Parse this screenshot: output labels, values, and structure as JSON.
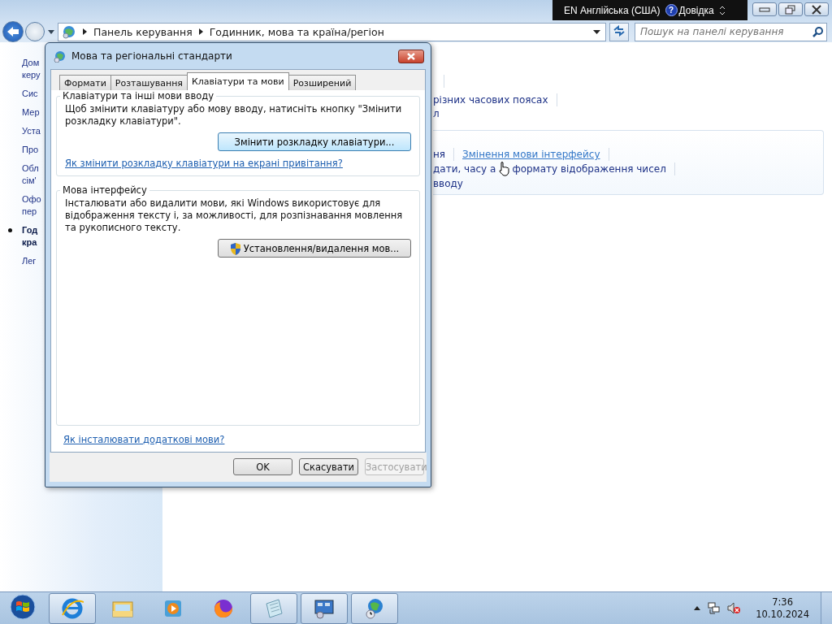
{
  "window": {
    "language_bar": {
      "language": "EN Англійська (США)",
      "help_icon": "?",
      "help": "Довідка"
    },
    "breadcrumbs": [
      "Панель керування",
      "Годинник, мова та країна/регіон"
    ],
    "search": {
      "placeholder": "Пошук на панелі керування"
    }
  },
  "sidebar": {
    "items": [
      {
        "lines": [
          "Дом",
          "керу"
        ],
        "selected": false
      },
      {
        "lines": [
          "Сис"
        ],
        "selected": false
      },
      {
        "lines": [
          "Мер"
        ],
        "selected": false
      },
      {
        "lines": [
          "Уста"
        ],
        "selected": false
      },
      {
        "lines": [
          "Про"
        ],
        "selected": false
      },
      {
        "lines": [
          "Обл",
          "сім'"
        ],
        "selected": false
      },
      {
        "lines": [
          "Офо",
          "пер"
        ],
        "selected": false
      },
      {
        "lines": [
          "Год",
          "кра"
        ],
        "selected": true
      },
      {
        "lines": [
          "Лег"
        ],
        "selected": false
      }
    ]
  },
  "main": {
    "links": [
      "різних часових поясах",
      "л"
    ],
    "panel": {
      "rows": [
        {
          "kind": "separated",
          "items": [
            {
              "text": "ня",
              "hover": false
            },
            {
              "text": "Змінення мови інтерфейсу",
              "hover": true
            }
          ]
        },
        {
          "kind": "cursor",
          "items": [
            {
              "text": "дати, часу а",
              "hover": false
            },
            {
              "text": "формату відображення чисел",
              "hover": false
            }
          ]
        },
        {
          "kind": "plain",
          "items": [
            {
              "text": "вводу",
              "hover": false
            }
          ]
        }
      ]
    }
  },
  "dialog": {
    "title": "Мова та регіональні стандарти",
    "tabs": [
      {
        "label": "Формати",
        "selected": false
      },
      {
        "label": "Розташування",
        "selected": false
      },
      {
        "label": "Клавіатури та мови",
        "selected": true
      },
      {
        "label": "Розширений",
        "selected": false
      }
    ],
    "groups": [
      {
        "title": "Клавіатури та інші мови вводу",
        "text": "Щоб змінити клавіатуру або мову вводу, натисніть кнопку \"Змінити розкладку клавіатури\".",
        "button": {
          "label": "Змінити розкладку клавіатури...",
          "shield": false,
          "focused": true
        },
        "link": "Як змінити розкладку клавіатури на екрані привітання?"
      },
      {
        "title": "Мова інтерфейсу",
        "text": "Інсталювати або видалити мови, які Windows використовує для відображення тексту і, за можливості, для розпізнавання мовлення та рукописного тексту.",
        "button": {
          "label": "Установлення/видалення мов...",
          "shield": true,
          "focused": false
        }
      }
    ],
    "link": "Як інсталювати додаткові мови?",
    "buttons": [
      {
        "label": "OK",
        "disabled": false
      },
      {
        "label": "Скасувати",
        "disabled": false
      },
      {
        "label": "Застосувати",
        "disabled": true
      }
    ]
  },
  "taskbar": {
    "apps": [
      {
        "kind": "browser-e",
        "running": true
      },
      {
        "kind": "folder",
        "running": false
      },
      {
        "kind": "media",
        "running": false
      },
      {
        "kind": "fox",
        "running": false
      },
      {
        "kind": "notepad",
        "running": true
      },
      {
        "kind": "control",
        "running": true
      },
      {
        "kind": "globe",
        "running": true
      }
    ],
    "clock": {
      "time": "7:36",
      "date": "10.10.2024"
    }
  }
}
